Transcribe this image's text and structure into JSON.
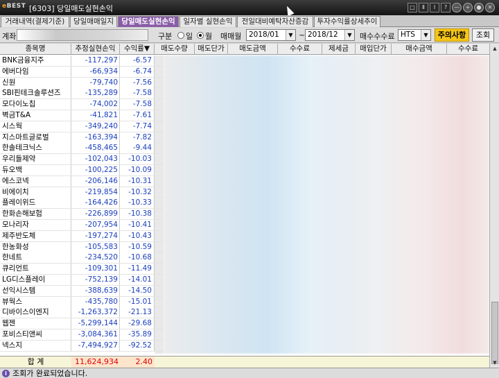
{
  "app": {
    "logo_text": "BEST",
    "title": "[6303] 당일매도실현손익",
    "title_buttons": [
      "□",
      "Ⅱ",
      "Ⅰ",
      "?",
      "—",
      "+",
      "●",
      "✕"
    ]
  },
  "tabs": [
    {
      "label": "거래내역(결제기준)",
      "active": false
    },
    {
      "label": "당일매매일지",
      "active": false
    },
    {
      "label": "당일매도실현손익",
      "active": true
    },
    {
      "label": "일자별 실현손익",
      "active": false
    },
    {
      "label": "전일대비예탁자산증감",
      "active": false
    },
    {
      "label": "투자수익률상세추이",
      "active": false
    }
  ],
  "controls": {
    "account_label": "계좌",
    "type_label": "구분",
    "radio_day": "일",
    "radio_month": "월",
    "radio_selected": "월",
    "period_label": "매매월",
    "from": "2018/01",
    "tilde": "~",
    "to": "2018/12",
    "fee_label": "매수수수료",
    "fee_value": "HTS",
    "notice_button": "주의사항",
    "query_button": "조회"
  },
  "columns": [
    "종목명",
    "추정실현손익",
    "수익률▼",
    "매도수량",
    "매도단가",
    "매도금액",
    "수수료",
    "제세금",
    "매입단가",
    "매수금액",
    "수수료"
  ],
  "rows": [
    {
      "name": "BNK금융지주",
      "pl": "-117,297",
      "rate": "-6.57"
    },
    {
      "name": "에버다임",
      "pl": "-66,934",
      "rate": "-6.74"
    },
    {
      "name": "신원",
      "pl": "-79,740",
      "rate": "-7.56"
    },
    {
      "name": "SBI핀테크솔루션즈",
      "pl": "-135,289",
      "rate": "-7.58"
    },
    {
      "name": "모다이노칩",
      "pl": "-74,002",
      "rate": "-7.58"
    },
    {
      "name": "벽금T&A",
      "pl": "-41,821",
      "rate": "-7.61"
    },
    {
      "name": "시스웍",
      "pl": "-349,240",
      "rate": "-7.74"
    },
    {
      "name": "지스마트글로벌",
      "pl": "-163,394",
      "rate": "-7.82"
    },
    {
      "name": "한솔테크닉스",
      "pl": "-458,465",
      "rate": "-9.44"
    },
    {
      "name": "우리들제약",
      "pl": "-102,043",
      "rate": "-10.03"
    },
    {
      "name": "듀오백",
      "pl": "-100,225",
      "rate": "-10.09"
    },
    {
      "name": "에스코넥",
      "pl": "-206,146",
      "rate": "-10.31"
    },
    {
      "name": "비에이치",
      "pl": "-219,854",
      "rate": "-10.32"
    },
    {
      "name": "플레이위드",
      "pl": "-164,426",
      "rate": "-10.33"
    },
    {
      "name": "한화손해보험",
      "pl": "-226,899",
      "rate": "-10.38"
    },
    {
      "name": "모나리자",
      "pl": "-207,954",
      "rate": "-10.41"
    },
    {
      "name": "제주반도체",
      "pl": "-197,274",
      "rate": "-10.43"
    },
    {
      "name": "한농화성",
      "pl": "-105,583",
      "rate": "-10.59"
    },
    {
      "name": "한네트",
      "pl": "-234,520",
      "rate": "-10.68"
    },
    {
      "name": "큐리언트",
      "pl": "-109,301",
      "rate": "-11.49"
    },
    {
      "name": "LG디스플레이",
      "pl": "-752,139",
      "rate": "-14.01"
    },
    {
      "name": "선익시스템",
      "pl": "-388,639",
      "rate": "-14.50"
    },
    {
      "name": "뷰웍스",
      "pl": "-435,780",
      "rate": "-15.01"
    },
    {
      "name": "디바이스이엔지",
      "pl": "-1,263,372",
      "rate": "-21.13"
    },
    {
      "name": "웹젠",
      "pl": "-5,299,144",
      "rate": "-29.68"
    },
    {
      "name": "포비스티앤씨",
      "pl": "-3,084,361",
      "rate": "-35.89"
    },
    {
      "name": "넥스지",
      "pl": "-7,494,927",
      "rate": "-92.52"
    }
  ],
  "total": {
    "label": "합 계",
    "pl": "11,624,934",
    "rate": "2.40"
  },
  "status": {
    "icon": "i",
    "message": "조회가 완료되었습니다."
  }
}
